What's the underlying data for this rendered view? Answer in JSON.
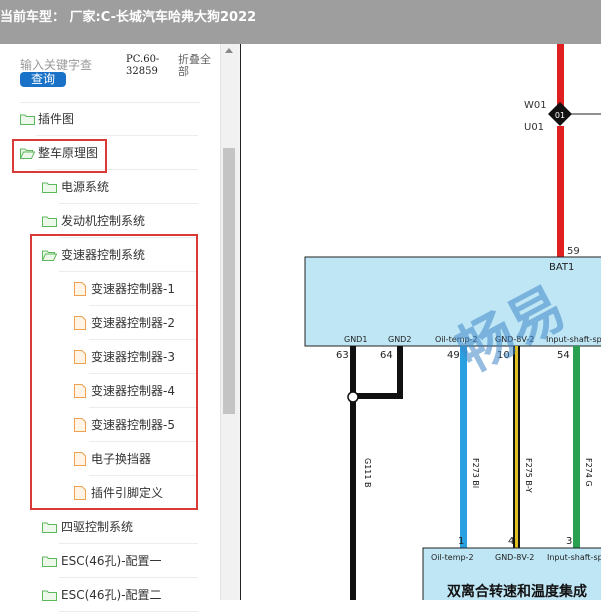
{
  "header": {
    "prefix": "当前车型：",
    "vehicle": "厂家:C-长城汽车哈弗大狗2022"
  },
  "sidebar": {
    "search_placeholder": "输入关键字查",
    "search_button": "查询",
    "version": "PC.60-32859",
    "collapse_all": "折叠全部",
    "items": [
      {
        "label": "插件图",
        "type": "folder",
        "level": 0
      },
      {
        "label": "整车原理图",
        "type": "folder-open",
        "level": 0
      },
      {
        "label": "电源系统",
        "type": "folder",
        "level": 1
      },
      {
        "label": "发动机控制系统",
        "type": "folder",
        "level": 1
      },
      {
        "label": "变速器控制系统",
        "type": "folder-open",
        "level": 1
      },
      {
        "label": "变速器控制器-1",
        "type": "file",
        "level": 2
      },
      {
        "label": "变速器控制器-2",
        "type": "file",
        "level": 2
      },
      {
        "label": "变速器控制器-3",
        "type": "file",
        "level": 2
      },
      {
        "label": "变速器控制器-4",
        "type": "file",
        "level": 2
      },
      {
        "label": "变速器控制器-5",
        "type": "file",
        "level": 2
      },
      {
        "label": "电子换挡器",
        "type": "file",
        "level": 2
      },
      {
        "label": "插件引脚定义",
        "type": "file",
        "level": 2
      },
      {
        "label": "四驱控制系统",
        "type": "folder",
        "level": 1
      },
      {
        "label": "ESC(46孔)-配置一",
        "type": "folder",
        "level": 1
      },
      {
        "label": "ESC(46孔)-配置二",
        "type": "folder",
        "level": 1
      }
    ]
  },
  "diagram": {
    "wire_labels": [
      "W01",
      "U01"
    ],
    "junction_label": "01",
    "pin_top": "59",
    "bat_label": "BAT1",
    "ecu_pins": [
      {
        "name": "GND1",
        "pin": "63"
      },
      {
        "name": "GND2",
        "pin": "64"
      },
      {
        "name": "Oil-temp-2",
        "pin": "49"
      },
      {
        "name": "GND-8V-2",
        "pin": "10"
      },
      {
        "name": "Input-shaft-sp",
        "pin": "54"
      }
    ],
    "wire_codes": [
      "G111 B",
      "F273 Bl",
      "F275 B-Y",
      "F274 G"
    ],
    "sensor_pins": [
      {
        "name": "Oil-temp-2",
        "pin": "1"
      },
      {
        "name": "GND-8V-2",
        "pin": "4"
      },
      {
        "name": "Input-shaft-sp",
        "pin": "3"
      }
    ],
    "sensor_title": "双离合转速和温度集成",
    "watermark": "畅易"
  },
  "colors": {
    "highlight_box": "#d93a36",
    "ecu_fill": "#bfe6f5",
    "wire_red": "#e02020",
    "wire_blue": "#2aa0e0",
    "wire_green": "#2aa050",
    "wire_yellow": "#e0c020",
    "folder": "#5cb85c",
    "file": "#f0a050"
  }
}
